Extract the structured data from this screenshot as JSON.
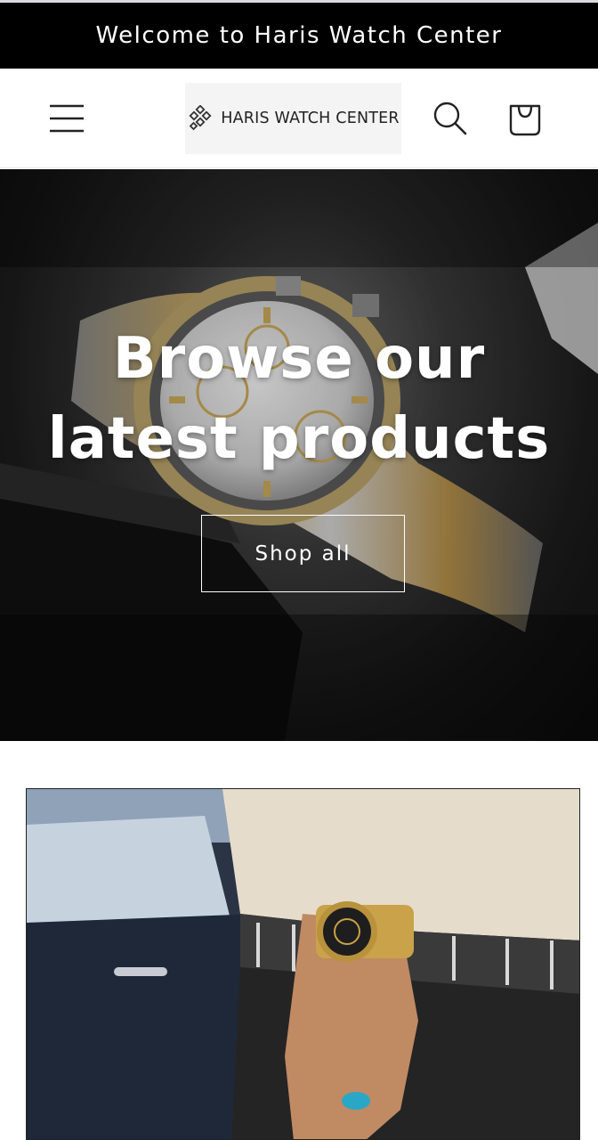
{
  "announcement": {
    "text": "Welcome to Haris Watch Center"
  },
  "header": {
    "logo_text": "HARIS WATCH CENTER",
    "icons": {
      "menu": "hamburger-menu-icon",
      "search": "search-icon",
      "cart": "cart-icon"
    }
  },
  "hero": {
    "heading_line1": "Browse our",
    "heading_line2": "latest products",
    "cta_label": "Shop all"
  },
  "colors": {
    "announcement_bg": "#000000",
    "announcement_text": "#ffffff",
    "header_bg": "#ffffff",
    "hero_text": "#ffffff"
  }
}
